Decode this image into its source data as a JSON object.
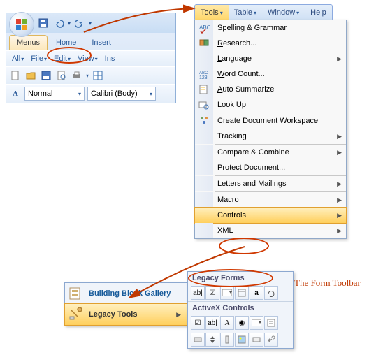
{
  "ribbon": {
    "tabs": {
      "menus": "Menus",
      "home": "Home",
      "insert": "Insert"
    },
    "row1": {
      "all": "All",
      "file": "File",
      "edit": "Edit",
      "view": "View",
      "ins": "Ins"
    },
    "row2": {
      "normal": "Normal",
      "font": "Calibri (Body)"
    }
  },
  "menubar": {
    "tools": "Tools",
    "table": "Table",
    "window": "Window",
    "help": "Help"
  },
  "dd": {
    "spelling": "pelling & Grammar",
    "research": "esearch...",
    "language": "anguage",
    "wordcount": "ord Count...",
    "autosum": "uto Summarize",
    "lookup": "Look Up",
    "cdw": "reate Document Workspace",
    "tracking": "Tracking",
    "cc": "Compare & Combine",
    "protect": "rotect Document...",
    "lm": "Letters and Mailings",
    "macro": "acro",
    "controls": "Controls",
    "xml": "XML"
  },
  "popup": {
    "bbg": "Building Block Gallery",
    "lt": "Legacy Tools",
    "lf": "Legacy Forms",
    "ac": "ActiveX Controls"
  },
  "caption": "The Form Toolbar"
}
